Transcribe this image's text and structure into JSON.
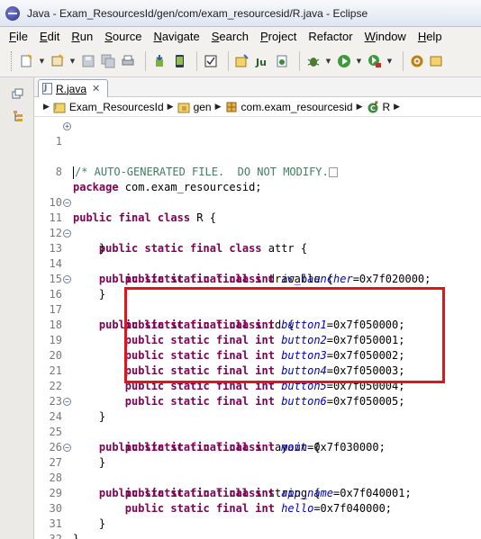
{
  "window": {
    "title": "Java - Exam_ResourcesId/gen/com/exam_resourcesid/R.java - Eclipse"
  },
  "menu": [
    {
      "mnemonic": "F",
      "rest": "ile"
    },
    {
      "mnemonic": "E",
      "rest": "dit"
    },
    {
      "mnemonic": "R",
      "rest": "un"
    },
    {
      "mnemonic": "S",
      "rest": "ource"
    },
    {
      "mnemonic": "N",
      "rest": "avigate"
    },
    {
      "mnemonic": "S",
      "rest": "earch"
    },
    {
      "mnemonic": "P",
      "rest": "roject"
    },
    {
      "mnemonic": "",
      "rest": "Refactor"
    },
    {
      "mnemonic": "W",
      "rest": "indow"
    },
    {
      "mnemonic": "H",
      "rest": "elp"
    }
  ],
  "editor_tab": {
    "label": "R.java",
    "close": "✕"
  },
  "breadcrumb": {
    "project": "Exam_ResourcesId",
    "folder": "gen",
    "package": "com.exam_resourcesid",
    "class": "R"
  },
  "code": {
    "l1": "/* AUTO-GENERATED FILE.  DO NOT MODIFY.",
    "l8_pkg": "package",
    "l8_name": " com.exam_resourcesid;",
    "l10_name": " R {",
    "attr": " attr {",
    "drawable": " drawable {",
    "ic_launcher": "ic_launcher",
    "ic_launcher_val": "=0x7f020000;",
    "id": " id {",
    "button1": "button1",
    "button1_val": "=0x7f050000;",
    "button2": "button2",
    "button2_val": "=0x7f050001;",
    "button3": "button3",
    "button3_val": "=0x7f050002;",
    "button4": "button4",
    "button4_val": "=0x7f050003;",
    "button5": "button5",
    "button5_val": "=0x7f050004;",
    "button6": "button6",
    "button6_val": "=0x7f050005;",
    "layout": " layout {",
    "main": "main",
    "main_val": "=0x7f030000;",
    "string": " string {",
    "app_name": "app_name",
    "app_name_val": "=0x7f040001;",
    "hello": "hello",
    "hello_val": "=0x7f040000;",
    "open_brace": "}",
    "kw_psfc": "public static final class",
    "kw_psfi": "public static final int",
    "kw_pfc": "public final class"
  },
  "line_numbers": [
    "1",
    "8",
    "10",
    "11",
    "12",
    "13",
    "14",
    "15",
    "16",
    "17",
    "18",
    "19",
    "20",
    "21",
    "22",
    "23",
    "24",
    "25",
    "26",
    "27",
    "28",
    "29",
    "30",
    "31",
    "32"
  ],
  "colors": {
    "keyword": "#7f0055",
    "field": "#0000c0",
    "comment": "#3f7f5f",
    "highlight": "#e2141b"
  }
}
